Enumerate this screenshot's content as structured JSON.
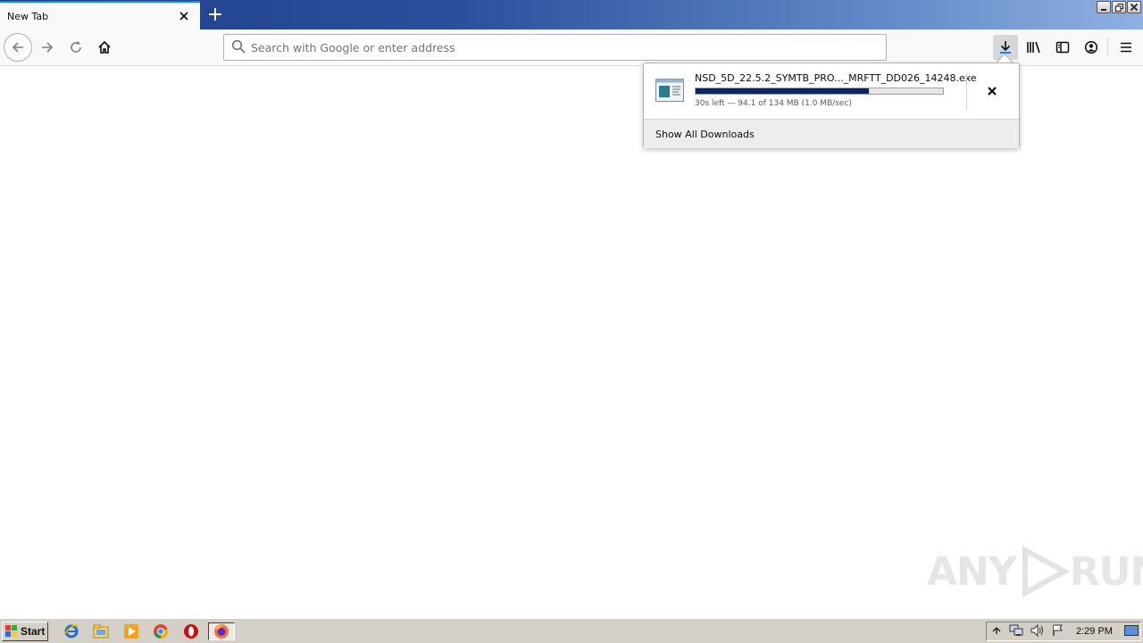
{
  "browser": {
    "tab": {
      "title": "New Tab"
    },
    "urlbar": {
      "placeholder": "Search with Google or enter address"
    }
  },
  "downloads_panel": {
    "item": {
      "filename": "NSD_5D_22.5.2_SYMTB_PRO..._MRFTT_DD026_14248.exe",
      "status": "30s left — 94.1 of 134 MB (1.0 MB/sec)",
      "progress": 0.702
    },
    "footer_label": "Show All Downloads"
  },
  "watermark": {
    "left": "ANY",
    "right": "RUN"
  },
  "taskbar": {
    "start_label": "Start",
    "pinned": [
      "ie-icon",
      "explorer-icon",
      "media-player-icon",
      "chrome-icon",
      "opera-icon",
      "firefox-icon"
    ],
    "clock": "2:29 PM"
  },
  "colors": {
    "accent": "#0a84ff",
    "progress_fill": "#0a246a",
    "titlebar": "#1f3f8a"
  }
}
